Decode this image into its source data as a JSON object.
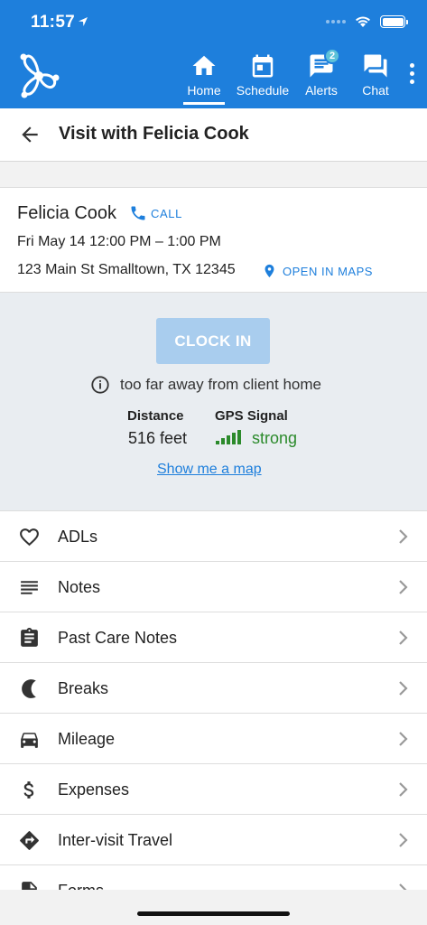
{
  "status_bar": {
    "time": "11:57"
  },
  "nav": {
    "items": [
      {
        "label": "Home",
        "icon": "home-icon",
        "active": true
      },
      {
        "label": "Schedule",
        "icon": "calendar-icon"
      },
      {
        "label": "Alerts",
        "icon": "alerts-icon",
        "badge": "2"
      },
      {
        "label": "Chat",
        "icon": "chat-icon"
      }
    ]
  },
  "header": {
    "title": "Visit with Felicia Cook"
  },
  "client": {
    "name": "Felicia Cook",
    "call_label": "CALL",
    "time": "Fri May 14 12:00 PM – 1:00 PM",
    "address": "123 Main St Smalltown, TX 12345",
    "maps_label": "OPEN IN MAPS"
  },
  "clock": {
    "button_label": "CLOCK IN",
    "warning": "too far away from client home",
    "distance_label": "Distance",
    "distance_value": "516 feet",
    "gps_label": "GPS Signal",
    "gps_value": "strong",
    "show_map_label": "Show me a map"
  },
  "menu": [
    {
      "label": "ADLs",
      "icon": "heart-icon"
    },
    {
      "label": "Notes",
      "icon": "notes-icon"
    },
    {
      "label": "Past Care Notes",
      "icon": "clipboard-icon"
    },
    {
      "label": "Breaks",
      "icon": "moon-icon"
    },
    {
      "label": "Mileage",
      "icon": "car-icon"
    },
    {
      "label": "Expenses",
      "icon": "dollar-icon"
    },
    {
      "label": "Inter-visit Travel",
      "icon": "directions-icon"
    },
    {
      "label": "Forms",
      "icon": "form-icon"
    }
  ],
  "colors": {
    "brand": "#1e7fdc",
    "disabled_button": "#a9cdee",
    "gps_strong": "#2b8a2b"
  }
}
